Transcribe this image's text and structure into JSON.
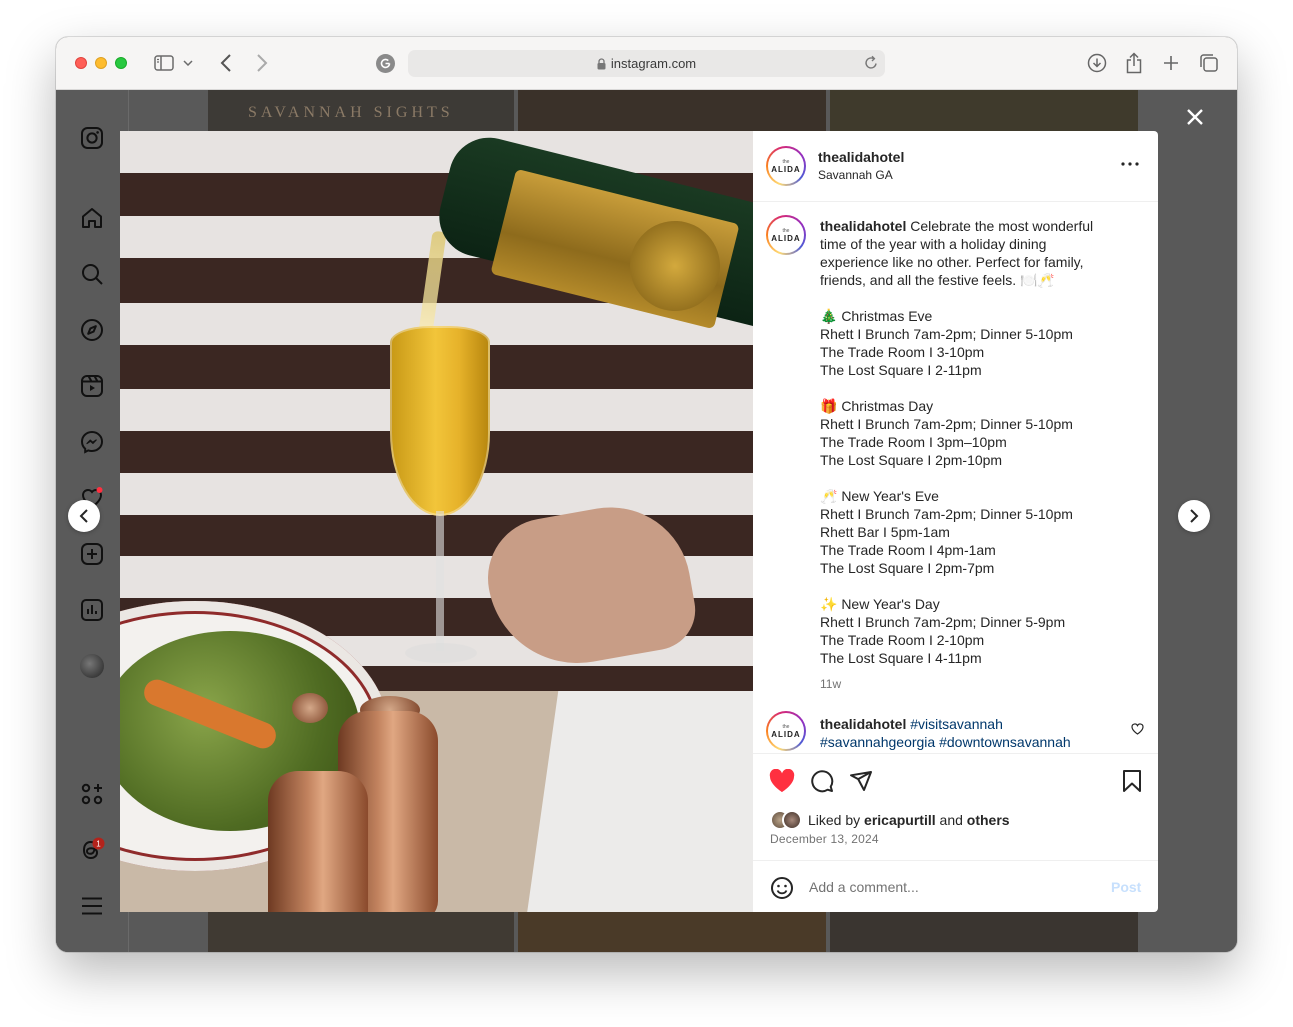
{
  "browser": {
    "url": "instagram.com",
    "tab_icon": "sidebar-icon"
  },
  "post": {
    "username": "thealidahotel",
    "location": "Savannah GA",
    "avatar_label": "ALIDA",
    "avatar_small": "the",
    "caption_lines": [
      "Celebrate the most wonderful",
      "time of the year with a holiday dining",
      "experience like no other. Perfect for family,",
      "friends, and all the festive feels. 🍽️🥂",
      "",
      "🎄 Christmas Eve",
      "Rhett I Brunch 7am-2pm; Dinner 5-10pm",
      "The Trade Room I 3-10pm",
      "The Lost Square I 2-11pm",
      "",
      "🎁 Christmas Day",
      "Rhett I Brunch 7am-2pm; Dinner 5-10pm",
      "The Trade Room I 3pm–10pm",
      "The Lost Square I 2pm-10pm",
      "",
      "🥂 New Year's Eve",
      "Rhett I Brunch 7am-2pm; Dinner 5-10pm",
      "Rhett Bar I 5pm-1am",
      "The Trade Room I 4pm-1am",
      "The Lost Square I 2pm-7pm",
      "",
      "✨ New Year's Day",
      "Rhett I Brunch 7am-2pm; Dinner 5-9pm",
      "The Trade Room I 2-10pm",
      "The Lost Square I 4-11pm"
    ],
    "time_ago": "11w",
    "comment2": {
      "username": "thealidahotel",
      "hashtag1": "#visitsavannah",
      "hashtag2": "#savannahgeorgia",
      "hashtag3": "#downtownsavannah"
    },
    "liked_by_prefix": "Liked by",
    "liked_by_user": "ericapurtill",
    "liked_by_and": "and",
    "liked_by_others": "others",
    "date": "December 13, 2024",
    "comment_placeholder": "Add a comment...",
    "post_label": "Post"
  },
  "background": {
    "tile_text": "SAVANNAH SIGHTS"
  },
  "sidebar": {
    "notification_badge": "1"
  },
  "colors": {
    "like_red": "#ff3040",
    "link_blue": "#00376b",
    "post_disabled": "#c7e0fd"
  }
}
